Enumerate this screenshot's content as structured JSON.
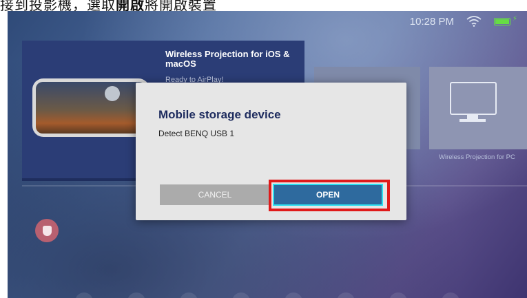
{
  "caption": {
    "text_prefix": "接到投影機，選取",
    "text_bold": "開啟",
    "text_suffix": "將開啟裝置"
  },
  "status_bar": {
    "time": "10:28 PM",
    "wifi_icon": "wifi-icon",
    "battery_icon": "battery-charging-icon",
    "battery_color": "#66dd44"
  },
  "home": {
    "ios_card": {
      "title": "Wireless Projection for iOS & macOS",
      "subtitle": "Ready to AirPlay!"
    },
    "pc_tile": {
      "label": "Wireless Projection for PC",
      "icon": "monitor-icon"
    },
    "app_icon": "pocket-icon"
  },
  "dialog": {
    "title": "Mobile storage device",
    "message": "Detect BENQ USB 1",
    "cancel_label": "CANCEL",
    "open_label": "OPEN",
    "highlight_color": "#e01a1a",
    "focus_color": "#2de0f0"
  }
}
